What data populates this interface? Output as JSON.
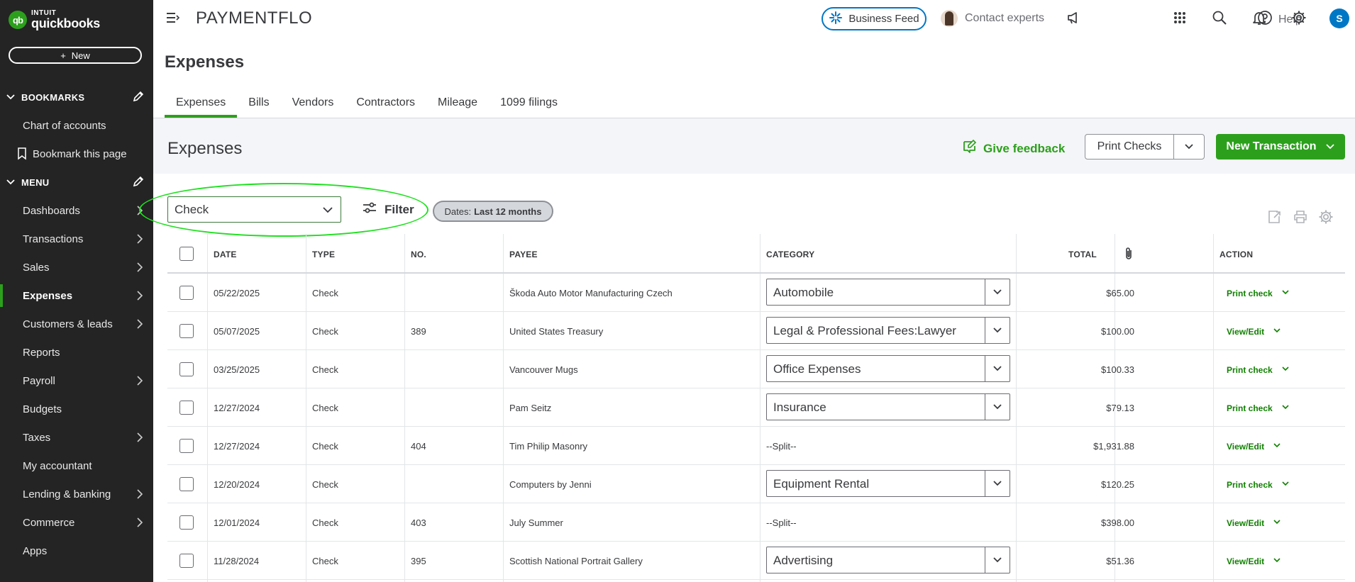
{
  "brand": {
    "badge": "qb",
    "line1": "INTUIT",
    "line2": "quickbooks"
  },
  "sidebar": {
    "new_label": "New",
    "bookmarks_label": "BOOKMARKS",
    "menu_label": "MENU",
    "bookmark_items": [
      {
        "label": "Chart of accounts"
      },
      {
        "label": "Bookmark this page"
      }
    ],
    "menu_items": [
      {
        "label": "Dashboards"
      },
      {
        "label": "Transactions"
      },
      {
        "label": "Sales"
      },
      {
        "label": "Expenses"
      },
      {
        "label": "Customers & leads"
      },
      {
        "label": "Reports"
      },
      {
        "label": "Payroll"
      },
      {
        "label": "Budgets"
      },
      {
        "label": "Taxes"
      },
      {
        "label": "My accountant"
      },
      {
        "label": "Lending & banking"
      },
      {
        "label": "Commerce"
      },
      {
        "label": "Apps"
      }
    ]
  },
  "topbar": {
    "company_name": "PAYMENTFLO",
    "business_feed": "Business Feed",
    "contact_experts": "Contact experts",
    "help": "Help",
    "user_initial": "S"
  },
  "page": {
    "title": "Expenses",
    "tabs": [
      {
        "label": "Expenses"
      },
      {
        "label": "Bills"
      },
      {
        "label": "Vendors"
      },
      {
        "label": "Contractors"
      },
      {
        "label": "Mileage"
      },
      {
        "label": "1099 filings"
      }
    ]
  },
  "panel": {
    "title": "Expenses",
    "give_feedback": "Give feedback",
    "print_checks": "Print Checks",
    "new_transaction": "New Transaction"
  },
  "filters": {
    "type_value": "Check",
    "filter_label": "Filter",
    "dates_prefix": "Dates:",
    "dates_value": "Last 12 months"
  },
  "table": {
    "headers": {
      "date": "DATE",
      "type": "TYPE",
      "no": "NO.",
      "payee": "PAYEE",
      "category": "CATEGORY",
      "total": "TOTAL",
      "action": "ACTION"
    },
    "rows": [
      {
        "date": "05/22/2025",
        "type": "Check",
        "no": "",
        "payee": "Škoda Auto Motor Manufacturing Czech",
        "category": "Automobile",
        "total": "$65.00",
        "action": "Print check"
      },
      {
        "date": "05/07/2025",
        "type": "Check",
        "no": "389",
        "payee": "United States Treasury",
        "category": "Legal & Professional Fees:Lawyer",
        "total": "$100.00",
        "action": "View/Edit"
      },
      {
        "date": "03/25/2025",
        "type": "Check",
        "no": "",
        "payee": "Vancouver Mugs",
        "category": "Office Expenses",
        "total": "$100.33",
        "action": "Print check"
      },
      {
        "date": "12/27/2024",
        "type": "Check",
        "no": "",
        "payee": "Pam Seitz",
        "category": "Insurance",
        "total": "$79.13",
        "action": "Print check"
      },
      {
        "date": "12/27/2024",
        "type": "Check",
        "no": "404",
        "payee": "Tim Philip Masonry",
        "split": "--Split--",
        "total": "$1,931.88",
        "action": "View/Edit"
      },
      {
        "date": "12/20/2024",
        "type": "Check",
        "no": "",
        "payee": "Computers by Jenni",
        "category": "Equipment Rental",
        "total": "$120.25",
        "action": "Print check"
      },
      {
        "date": "12/01/2024",
        "type": "Check",
        "no": "403",
        "payee": "July Summer",
        "split": "--Split--",
        "total": "$398.00",
        "action": "View/Edit"
      },
      {
        "date": "11/28/2024",
        "type": "Check",
        "no": "395",
        "payee": "Scottish National Portrait Gallery",
        "category": "Advertising",
        "total": "$51.36",
        "action": "View/Edit"
      }
    ]
  },
  "colors": {
    "brand_green": "#2ca01c",
    "sidebar_bg": "#242424",
    "link_blue": "#0077c5",
    "action_green": "#108000"
  }
}
